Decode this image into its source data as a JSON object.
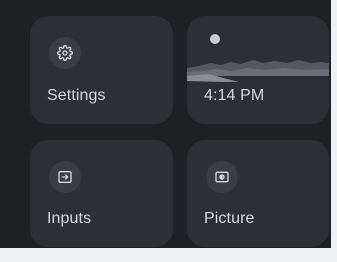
{
  "tiles": {
    "settings": {
      "label": "Settings",
      "icon": "gear-icon"
    },
    "clock": {
      "time": "4:14 PM",
      "icon": "moon-landscape-wallpaper"
    },
    "inputs": {
      "label": "Inputs",
      "icon": "input-source-icon"
    },
    "picture": {
      "label": "Picture",
      "icon": "picture-mode-icon"
    }
  },
  "colors": {
    "background": "#1f2024",
    "tile": "#2d2f35",
    "icon_circle": "#3a3d44",
    "text": "#d6d8dc"
  }
}
